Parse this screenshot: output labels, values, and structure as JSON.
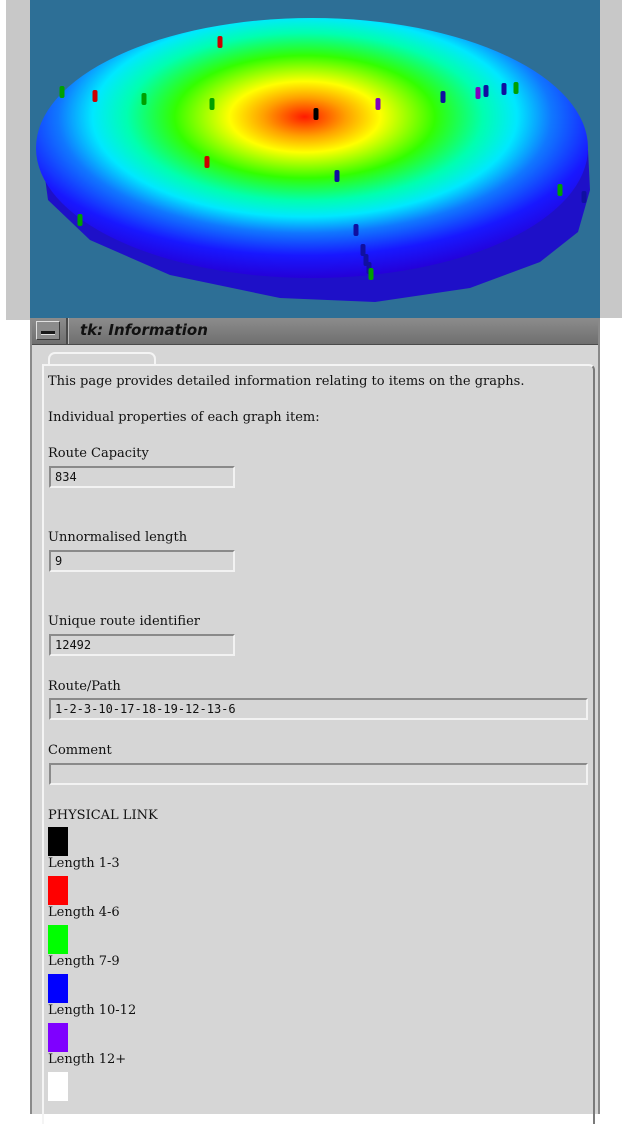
{
  "window": {
    "title": "tk: Information",
    "tab_label": ""
  },
  "info": {
    "intro": "This page provides detailed information relating to items on the graphs.",
    "properties_heading": "Individual properties of each graph item:",
    "fields": [
      {
        "label": "Route Capacity",
        "value": "834"
      },
      {
        "label": "Unnormalised length",
        "value": "9"
      },
      {
        "label": "Unique route identifier",
        "value": "12492"
      },
      {
        "label": "Route/Path",
        "value": "1-2-3-10-17-18-19-12-13-6"
      },
      {
        "label": "Comment",
        "value": ""
      }
    ]
  },
  "legend": {
    "title": "PHYSICAL LINK",
    "entries": [
      {
        "color": "#000000",
        "label": "Length 1-3"
      },
      {
        "color": "#ff0000",
        "label": "Length 4-6"
      },
      {
        "color": "#00ff00",
        "label": "Length 7-9"
      },
      {
        "color": "#0000ff",
        "label": "Length 10-12"
      },
      {
        "color": "#7f00ff",
        "label": "Length 12+"
      },
      {
        "color": "#ffffff",
        "label": ""
      }
    ]
  },
  "viewer": {
    "background": "#2d6f96",
    "surface_colors": [
      "#ff1a00",
      "#ffff00",
      "#00ff00",
      "#00ffff",
      "#0000ff"
    ]
  }
}
